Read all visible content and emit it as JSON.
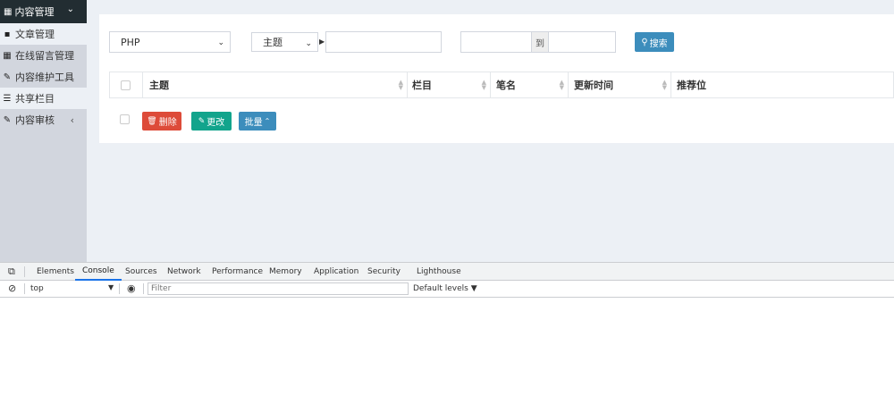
{
  "sidebar": {
    "header": "内容管理",
    "items": [
      {
        "label": "文章管理",
        "icon": "file-icon"
      },
      {
        "label": "在线留言管理",
        "icon": "table-icon"
      },
      {
        "label": "内容维护工具",
        "icon": "wrench-icon"
      },
      {
        "label": "共享栏目",
        "icon": "list-icon"
      },
      {
        "label": "内容审核",
        "icon": "edit-icon",
        "arrow": "‹"
      }
    ]
  },
  "filters": {
    "category": "PHP",
    "field": "主题",
    "keyword": "",
    "date_to": "到",
    "search_label": "搜索"
  },
  "table": {
    "columns": [
      "主题",
      "栏目",
      "笔名",
      "更新时间",
      "推荐位"
    ]
  },
  "actions": {
    "delete": "删除",
    "edit": "更改",
    "batch": "批量"
  },
  "devtools": {
    "tabs": [
      "Elements",
      "Console",
      "Sources",
      "Network",
      "Performance",
      "Memory",
      "Application",
      "Security",
      "Lighthouse"
    ],
    "active_tab": "Console",
    "context": "top",
    "filter_placeholder": "Filter",
    "levels": "Default levels ▼"
  },
  "colors": {
    "sidebar_dark": "#222d32",
    "primary": "#3c8dbc",
    "danger": "#dd4b39",
    "success": "#12a48c"
  }
}
